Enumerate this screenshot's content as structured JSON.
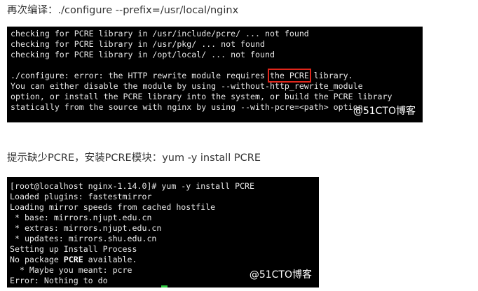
{
  "captions": {
    "recompile": "再次编译：./configure --prefix=/usr/local/nginx",
    "hint": "提示缺少PCRE，安装PCRE模块：yum -y install PCRE"
  },
  "terminal1": {
    "lines": [
      "checking for PCRE library in /usr/include/pcre/ ... not found",
      "checking for PCRE library in /usr/pkg/ ... not found",
      "checking for PCRE library in /opt/local/ ... not found"
    ],
    "error_prefix": "./configure: error: the HTTP rewrite module requires ",
    "error_highlight": "the PCRE",
    "error_suffix": " library.",
    "help_lines": [
      "You can either disable the module by using --without-http_rewrite_module",
      "option, or install the PCRE library into the system, or build the PCRE library",
      "statically from the source with nginx by using --with-pcre=<path> option."
    ],
    "watermark": "@51CTO博客"
  },
  "terminal2": {
    "prompt": "[root@localhost nginx-1.14.0]# yum -y install PCRE",
    "lines": [
      "Loaded plugins: fastestmirror",
      "Loading mirror speeds from cached hostfile",
      " * base: mirrors.njupt.edu.cn",
      " * extras: mirrors.njupt.edu.cn",
      " * updates: mirrors.shu.edu.cn",
      "Setting up Install Process"
    ],
    "no_package_prefix": "No package ",
    "no_package_bold": "PCRE",
    "no_package_suffix": " available.",
    "maybe": "  * Maybe you meant: pcre",
    "error": "Error: Nothing to do",
    "watermark": "@51CTO博客"
  },
  "colors": {
    "terminal_bg": "#000000",
    "terminal_fg": "#e8e8e8",
    "highlight_box": "#e0261b",
    "cursor": "#2ecc40"
  }
}
